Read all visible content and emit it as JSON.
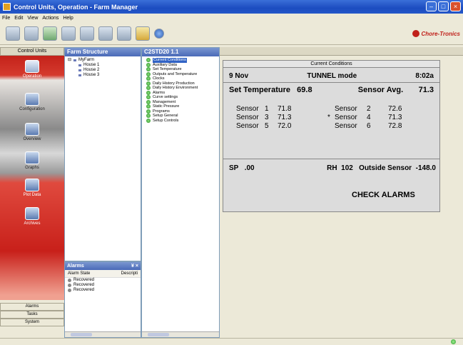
{
  "window": {
    "title": "Control Units, Operation - Farm Manager"
  },
  "menu": [
    "File",
    "Edit",
    "View",
    "Actions",
    "Help"
  ],
  "logo": {
    "text": "Chore-Tronics"
  },
  "nav": {
    "header": "Control Units",
    "items": [
      {
        "label": "Operation",
        "icon": "operation-icon"
      },
      {
        "label": "Configuration",
        "icon": "configuration-icon"
      },
      {
        "label": "Overview",
        "icon": "overview-icon"
      },
      {
        "label": "Graphs",
        "icon": "graphs-icon"
      },
      {
        "label": "Plot Data",
        "icon": "plot-data-icon"
      },
      {
        "label": "Archives",
        "icon": "archives-icon"
      }
    ],
    "bottom": [
      "Alarms",
      "Tasks",
      "System"
    ]
  },
  "farm_structure": {
    "header": "Farm Structure",
    "root": "MyFarm",
    "houses": [
      "House 1",
      "House 2",
      "House 3"
    ]
  },
  "alarms_panel": {
    "header": "Alarms",
    "pin": "¥",
    "close": "×",
    "columns": [
      "Alarm State",
      "Descripti"
    ],
    "rows": [
      "Recovered",
      "Recovered",
      "Recovered"
    ]
  },
  "device": {
    "header": "C2STD20 1.1",
    "items": [
      "Current Conditions",
      "Auxiliary Data",
      "Set Temperature",
      "Outputs and Temperature",
      "Clocks",
      "Daily History Production",
      "Daily History Environment",
      "Alarms",
      "Curve settings",
      "Management",
      "Static Pressure",
      "Programs",
      "Setup General",
      "Setup Controls"
    ],
    "selected_index": 0
  },
  "current_conditions": {
    "title": "Current Conditions",
    "date": "9 Nov",
    "mode": "TUNNEL mode",
    "time": "8:02a",
    "set_temp_label": "Set Temperature",
    "set_temp_value": "69.8",
    "sensor_avg_label": "Sensor Avg.",
    "sensor_avg_value": "71.3",
    "sensors": [
      {
        "label": "Sensor",
        "num": "1",
        "value": "71.8",
        "mark": "",
        "label2": "Sensor",
        "num2": "2",
        "value2": "72.6"
      },
      {
        "label": "Sensor",
        "num": "3",
        "value": "71.3",
        "mark": "*",
        "label2": "Sensor",
        "num2": "4",
        "value2": "71.3"
      },
      {
        "label": "Sensor",
        "num": "5",
        "value": "72.0",
        "mark": "",
        "label2": "Sensor",
        "num2": "6",
        "value2": "72.8"
      }
    ],
    "sp_label": "SP",
    "sp_value": ".00",
    "rh_label": "RH",
    "rh_value": "102",
    "outside_label": "Outside Sensor",
    "outside_value": "-148.0",
    "alert": "CHECK ALARMS"
  }
}
